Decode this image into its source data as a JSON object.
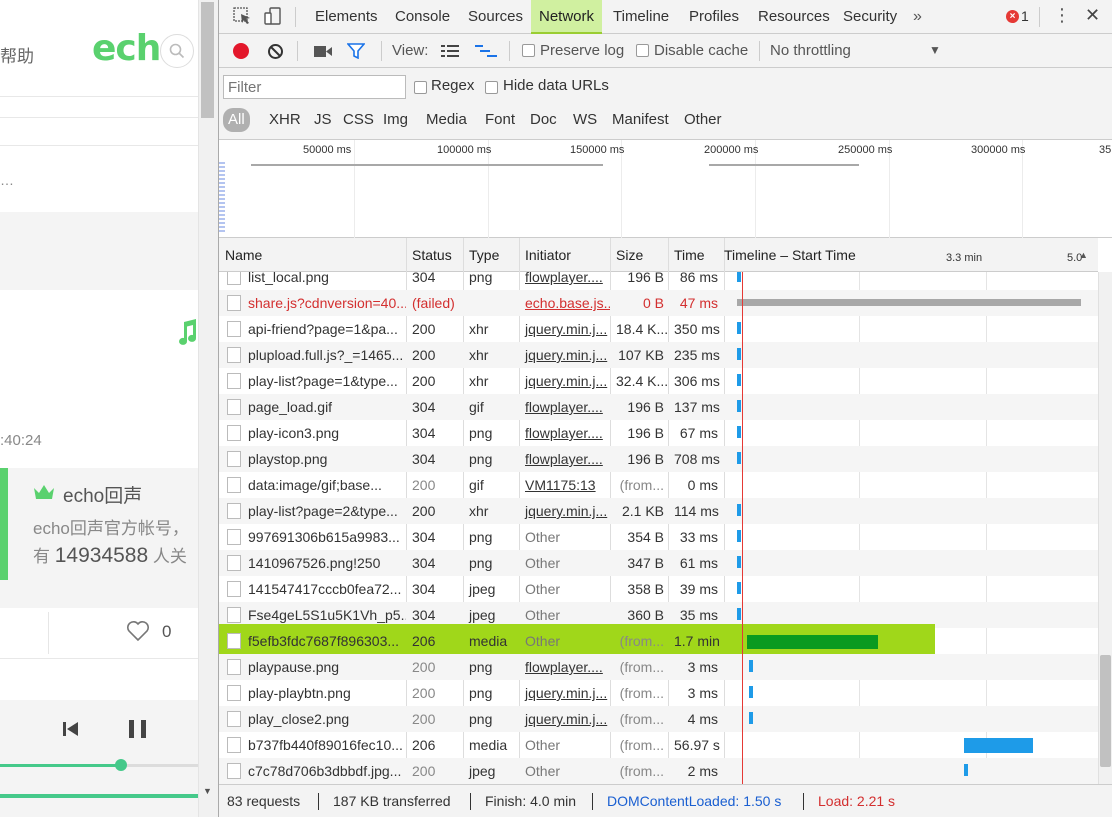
{
  "left_page": {
    "help_text": "帮助",
    "logo_text": "ech",
    "dots": "…",
    "time_text": ":40:24",
    "card_name": "echo回声",
    "card_desc": "echo回声官方帐号，",
    "card_fans_prefix": "有",
    "card_fans_count": "14934588",
    "card_fans_suffix": "人关",
    "like_count": "0",
    "progress": 0.61
  },
  "devtools": {
    "tabs": [
      {
        "label": "Elements"
      },
      {
        "label": "Console"
      },
      {
        "label": "Sources"
      },
      {
        "label": "Network",
        "active": true
      },
      {
        "label": "Timeline"
      },
      {
        "label": "Profiles"
      },
      {
        "label": "Resources"
      },
      {
        "label": "Security"
      }
    ],
    "more_tabs": "»",
    "error_count": "1",
    "toolbar": {
      "view_label": "View:",
      "preserve_log": "Preserve log",
      "disable_cache": "Disable cache",
      "throttling": "No throttling"
    },
    "filter": {
      "placeholder": "Filter",
      "regex": "Regex",
      "hide_data_urls": "Hide data URLs",
      "types": [
        "All",
        "XHR",
        "JS",
        "CSS",
        "Img",
        "Media",
        "Font",
        "Doc",
        "WS",
        "Manifest",
        "Other"
      ]
    },
    "overview": {
      "labels": [
        "50000 ms",
        "100000 ms",
        "150000 ms",
        "200000 ms",
        "250000 ms",
        "300000 ms",
        "35"
      ]
    },
    "columns": {
      "name": "Name",
      "status": "Status",
      "type": "Type",
      "initiator": "Initiator",
      "size": "Size",
      "time": "Time",
      "timeline": "Timeline – Start Time",
      "tl_marks": [
        "3.3 min",
        "5.0"
      ]
    },
    "rows": [
      {
        "name": "list_local.png",
        "status": "304",
        "type": "png",
        "initiator": "flowplayer....",
        "size": "196 B",
        "time": "86 ms",
        "bar": {
          "start": 0.0,
          "w": 0.01,
          "color": "#1e9be8"
        }
      },
      {
        "name": "share.js?cdnversion=40...",
        "status": "(failed)",
        "type": "",
        "initiator": "echo.base.js...",
        "size": "0 B",
        "time": "47 ms",
        "failed": true,
        "bar": {
          "start": 0.0,
          "w": 1.0,
          "color": "#a8a8a8"
        }
      },
      {
        "name": "api-friend?page=1&pa...",
        "status": "200",
        "type": "xhr",
        "initiator": "jquery.min.j...",
        "size": "18.4 K...",
        "time": "350 ms",
        "bar": {
          "start": 0.0,
          "w": 0.01,
          "color": "#1e9be8"
        }
      },
      {
        "name": "plupload.full.js?_=1465...",
        "status": "200",
        "type": "xhr",
        "initiator": "jquery.min.j...",
        "size": "107 KB",
        "time": "235 ms",
        "bar": {
          "start": 0.0,
          "w": 0.01,
          "color": "#1e9be8"
        }
      },
      {
        "name": "play-list?page=1&type...",
        "status": "200",
        "type": "xhr",
        "initiator": "jquery.min.j...",
        "size": "32.4 K...",
        "time": "306 ms",
        "bar": {
          "start": 0.0,
          "w": 0.01,
          "color": "#1e9be8"
        }
      },
      {
        "name": "page_load.gif",
        "status": "304",
        "type": "gif",
        "initiator": "flowplayer....",
        "size": "196 B",
        "time": "137 ms",
        "bar": {
          "start": 0.0,
          "w": 0.01,
          "color": "#1e9be8"
        }
      },
      {
        "name": "play-icon3.png",
        "status": "304",
        "type": "png",
        "initiator": "flowplayer....",
        "size": "196 B",
        "time": "67 ms",
        "bar": {
          "start": 0.0,
          "w": 0.01,
          "color": "#1e9be8"
        }
      },
      {
        "name": "playstop.png",
        "status": "304",
        "type": "png",
        "initiator": "flowplayer....",
        "size": "196 B",
        "time": "708 ms",
        "bar": {
          "start": 0.0,
          "w": 0.01,
          "color": "#1e9be8"
        }
      },
      {
        "name": "data:image/gif;base...",
        "status": "200",
        "type": "gif",
        "initiator": "VM1175:13",
        "size": "(from...",
        "time": "0 ms",
        "mutedStatus": true,
        "mutedSize": true
      },
      {
        "name": "play-list?page=2&type...",
        "status": "200",
        "type": "xhr",
        "initiator": "jquery.min.j...",
        "size": "2.1 KB",
        "time": "114 ms",
        "bar": {
          "start": 0.0,
          "w": 0.01,
          "color": "#1e9be8"
        }
      },
      {
        "name": "997691306b615a9983...",
        "status": "304",
        "type": "png",
        "initiator": "Other",
        "size": "354 B",
        "time": "33 ms",
        "plainInit": true,
        "bar": {
          "start": 0.0,
          "w": 0.01,
          "color": "#1e9be8"
        }
      },
      {
        "name": "1410967526.png!250",
        "status": "304",
        "type": "png",
        "initiator": "Other",
        "size": "347 B",
        "time": "61 ms",
        "plainInit": true,
        "bar": {
          "start": 0.0,
          "w": 0.01,
          "color": "#1e9be8"
        }
      },
      {
        "name": "141547417cccb0fea72...",
        "status": "304",
        "type": "jpeg",
        "initiator": "Other",
        "size": "358 B",
        "time": "39 ms",
        "plainInit": true,
        "bar": {
          "start": 0.0,
          "w": 0.01,
          "color": "#1e9be8"
        }
      },
      {
        "name": "Fse4geL5S1u5K1Vh_p5...",
        "status": "304",
        "type": "jpeg",
        "initiator": "Other",
        "size": "360 B",
        "time": "35 ms",
        "plainInit": true,
        "bar": {
          "start": 0.0,
          "w": 0.01,
          "color": "#1e9be8"
        }
      },
      {
        "name": "f5efb3fdc7687f896303...",
        "status": "206",
        "type": "media",
        "initiator": "Other",
        "size": "(from...",
        "time": "1.7 min",
        "plainInit": true,
        "mutedSize": true,
        "highlight": true,
        "bar": {
          "start": 0.03,
          "w": 0.38,
          "color": "#0a9a20"
        }
      },
      {
        "name": "playpause.png",
        "status": "200",
        "type": "png",
        "initiator": "flowplayer....",
        "size": "(from...",
        "time": "3 ms",
        "mutedStatus": true,
        "mutedSize": true,
        "bar": {
          "start": 0.035,
          "w": 0.01,
          "color": "#1e9be8"
        }
      },
      {
        "name": "play-playbtn.png",
        "status": "200",
        "type": "png",
        "initiator": "jquery.min.j...",
        "size": "(from...",
        "time": "3 ms",
        "mutedStatus": true,
        "mutedSize": true,
        "bar": {
          "start": 0.035,
          "w": 0.01,
          "color": "#1e9be8"
        }
      },
      {
        "name": "play_close2.png",
        "status": "200",
        "type": "png",
        "initiator": "jquery.min.j...",
        "size": "(from...",
        "time": "4 ms",
        "mutedStatus": true,
        "mutedSize": true,
        "bar": {
          "start": 0.035,
          "w": 0.01,
          "color": "#1e9be8"
        }
      },
      {
        "name": "b737fb440f89016fec10...",
        "status": "206",
        "type": "media",
        "initiator": "Other",
        "size": "(from...",
        "time": "56.97 s",
        "plainInit": true,
        "mutedSize": true,
        "bar": {
          "start": 0.66,
          "w": 0.2,
          "color": "#1e9be8"
        }
      },
      {
        "name": "c7c78d706b3dbbdf.jpg...",
        "status": "200",
        "type": "jpeg",
        "initiator": "Other",
        "size": "(from...",
        "time": "2 ms",
        "plainInit": true,
        "mutedStatus": true,
        "mutedSize": true,
        "bar": {
          "start": 0.66,
          "w": 0.01,
          "color": "#1e9be8"
        }
      }
    ],
    "status": {
      "requests": "83 requests",
      "transferred": "187 KB transferred",
      "finish": "Finish: 4.0 min",
      "dcl": "DOMContentLoaded: 1.50 s",
      "load": "Load: 2.21 s"
    },
    "colors": {
      "accent_tab": "#d0f0a0",
      "record": "#e3172b",
      "dcl": "#1a5fd1",
      "load": "#d32f2f",
      "highlight": "#a0d71a"
    }
  }
}
